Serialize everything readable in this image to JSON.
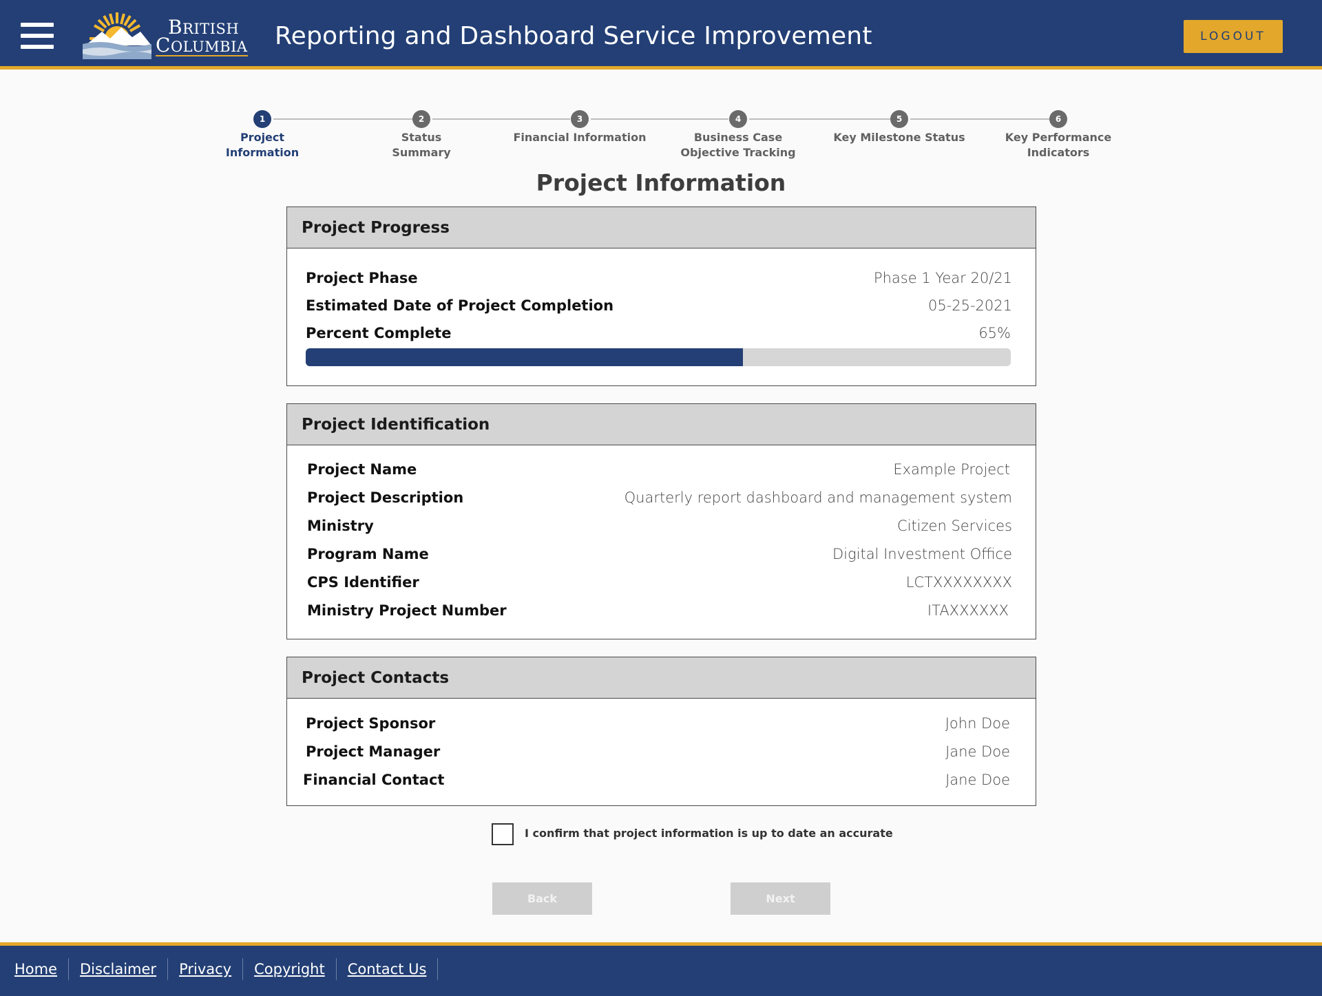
{
  "header": {
    "logo_line1": "British",
    "logo_line2": "Columbia",
    "title": "Reporting and Dashboard Service Improvement",
    "logout_label": "LOGOUT",
    "menu_icon": "hamburger-menu-icon"
  },
  "stepper": {
    "steps": [
      {
        "number": "1",
        "label_line1": "Project",
        "label_line2": "Information",
        "active": true
      },
      {
        "number": "2",
        "label_line1": "Status",
        "label_line2": "Summary",
        "active": false
      },
      {
        "number": "3",
        "label_line1": "Financial Information",
        "label_line2": "",
        "active": false
      },
      {
        "number": "4",
        "label_line1": "Business Case",
        "label_line2": "Objective Tracking",
        "active": false
      },
      {
        "number": "5",
        "label_line1": "Key Milestone Status",
        "label_line2": "",
        "active": false
      },
      {
        "number": "6",
        "label_line1": "Key Performance",
        "label_line2": "Indicators",
        "active": false
      }
    ]
  },
  "page_title": "Project Information",
  "progress_panel": {
    "title": "Project Progress",
    "rows": [
      {
        "label": "Project Phase",
        "value": "Phase 1 Year 20/21"
      },
      {
        "label": "Estimated Date of Project Completion",
        "value": "05-25-2021"
      },
      {
        "label": "Percent Complete",
        "value": "65%"
      }
    ],
    "percent_complete": 0.62
  },
  "identification_panel": {
    "title": "Project Identification",
    "rows": [
      {
        "label": "Project Name",
        "value": "Example Project"
      },
      {
        "label": "Project Description",
        "value": "Quarterly report dashboard and management system"
      },
      {
        "label": "Ministry",
        "value": "Citizen Services"
      },
      {
        "label": "Program Name",
        "value": "Digital Investment Office"
      },
      {
        "label": "CPS Identifier",
        "value": "LCTXXXXXXXX"
      },
      {
        "label": "Ministry Project Number",
        "value": "ITAXXXXXX"
      }
    ]
  },
  "contacts_panel": {
    "title": "Project Contacts",
    "rows": [
      {
        "label": "Project Sponsor",
        "value": "John Doe"
      },
      {
        "label": "Project Manager",
        "value": "Jane Doe"
      },
      {
        "label": "Financial Contact",
        "value": "Jane Doe"
      }
    ]
  },
  "confirm": {
    "label": "I confirm that project information is up to date an accurate",
    "checked": false
  },
  "buttons": {
    "back": "Back",
    "next": "Next"
  },
  "footer": {
    "links": [
      "Home",
      "Disclaimer",
      "Privacy",
      "Copyright",
      "Contact Us"
    ]
  },
  "colors": {
    "brand_blue": "#233f75",
    "brand_gold": "#e3a82b"
  }
}
